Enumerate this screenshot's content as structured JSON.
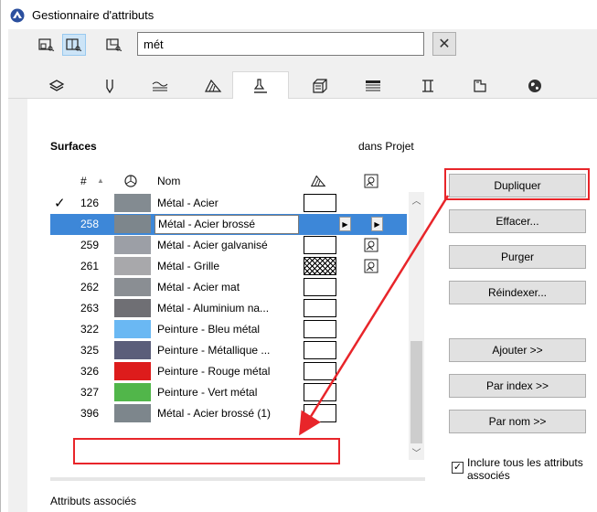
{
  "window": {
    "title": "Gestionnaire d'attributs"
  },
  "toolbar": {
    "buttons": [
      {
        "name": "view-list-icon",
        "active": false
      },
      {
        "name": "view-split-icon",
        "active": true
      },
      {
        "name": "view-compare-icon",
        "active": false
      }
    ],
    "search_value": "mét",
    "clear_label": "✕"
  },
  "tabs": [
    {
      "icon": "layers-icon"
    },
    {
      "icon": "pen-icon"
    },
    {
      "icon": "line-type-icon"
    },
    {
      "icon": "fill-icon"
    },
    {
      "icon": "surface-icon",
      "selected": true
    },
    {
      "icon": "building-material-icon"
    },
    {
      "icon": "composite-icon"
    },
    {
      "icon": "profile-icon"
    },
    {
      "icon": "zone-icon"
    },
    {
      "icon": "globe-icon"
    }
  ],
  "panel": {
    "title": "Surfaces",
    "scope": "dans Projet",
    "columns": {
      "num": "#",
      "sort_arrow": "▲",
      "name": "Nom"
    }
  },
  "rows": [
    {
      "check": "✓",
      "num": "126",
      "name": "Métal - Acier",
      "color": "#838b91",
      "hatch": "empty",
      "texture": false
    },
    {
      "check": "",
      "num": "258",
      "name": "Métal - Acier brossé",
      "color": "#7d868c",
      "hatch": "selected",
      "texture": false,
      "selected": true,
      "editing": true
    },
    {
      "check": "",
      "num": "259",
      "name": "Métal - Acier galvanisé",
      "color": "#9c9fa6",
      "hatch": "empty",
      "texture": true
    },
    {
      "check": "",
      "num": "261",
      "name": "Métal - Grille",
      "color": "#a8a8ab",
      "hatch": "crosshatch",
      "texture": true
    },
    {
      "check": "",
      "num": "262",
      "name": "Métal - Acier mat",
      "color": "#8a8e93",
      "hatch": "empty",
      "texture": false
    },
    {
      "check": "",
      "num": "263",
      "name": "Métal - Aluminium na...",
      "color": "#6f6f74",
      "hatch": "empty",
      "texture": false
    },
    {
      "check": "",
      "num": "322",
      "name": "Peinture - Bleu métal",
      "color": "#6ab8f3",
      "hatch": "empty",
      "texture": false
    },
    {
      "check": "",
      "num": "325",
      "name": "Peinture - Métallique ...",
      "color": "#5b5e7a",
      "hatch": "empty",
      "texture": false
    },
    {
      "check": "",
      "num": "326",
      "name": "Peinture - Rouge métal",
      "color": "#dd1c1c",
      "hatch": "empty",
      "texture": false
    },
    {
      "check": "",
      "num": "327",
      "name": "Peinture - Vert métal",
      "color": "#51b64a",
      "hatch": "empty",
      "texture": false
    },
    {
      "check": "",
      "num": "396",
      "name": "Métal - Acier brossé (1)",
      "color": "#7d868c",
      "hatch": "empty",
      "texture": false
    }
  ],
  "actions": {
    "duplicate": "Dupliquer",
    "delete": "Effacer...",
    "purge": "Purger",
    "reindex": "Réindexer...",
    "add": "Ajouter >>",
    "by_index": "Par index >>",
    "by_name": "Par nom >>"
  },
  "include_all": {
    "checked": true,
    "mark": "✓",
    "label": "Inclure tous les attributs associés"
  },
  "footer": {
    "section_label": "Attributs associés"
  },
  "colors": {
    "selection": "#3d87d8",
    "highlight": "#e8252a",
    "accent": "#cce4f7"
  }
}
